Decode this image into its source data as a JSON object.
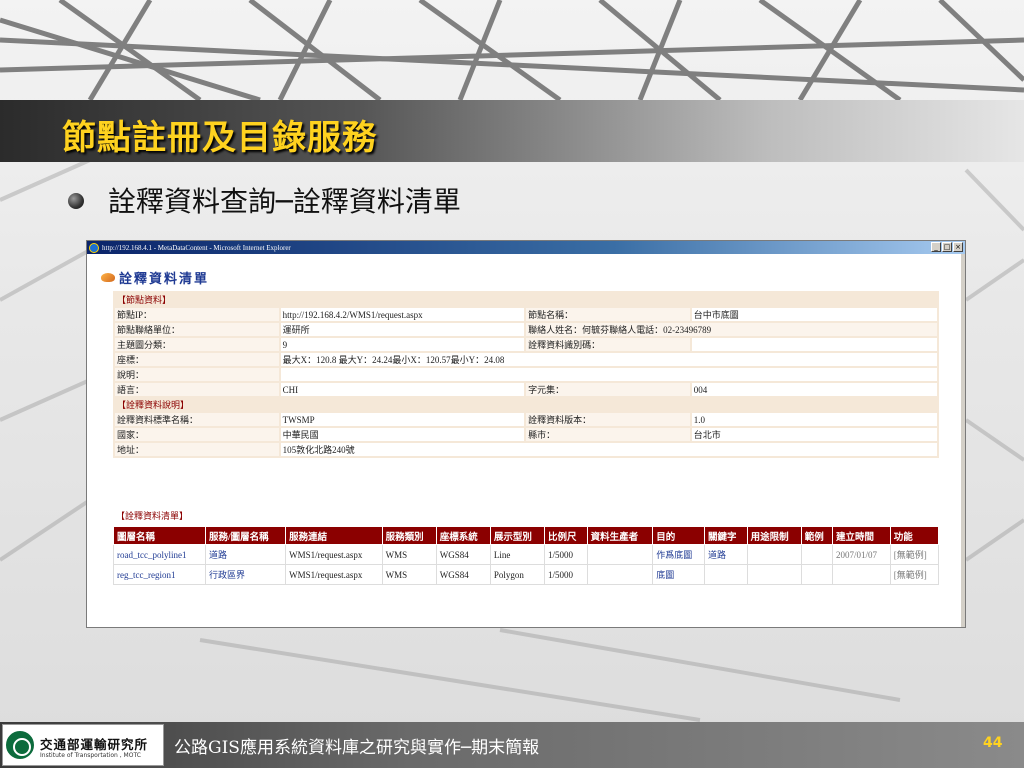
{
  "slide": {
    "title": "節點註冊及目錄服務",
    "bullet": "詮釋資料查詢─詮釋資料清單",
    "footer_text": "公路GIS應用系統資料庫之研究與實作─期末簡報",
    "page_number": "44",
    "org_name": "交通部運輸研究所",
    "org_name_en": "Institute of Transportation , MOTC"
  },
  "window": {
    "title": "http://192.168.4.1 - MetaDataContent - Microsoft Internet Explorer",
    "minimize": "_",
    "maximize": "□",
    "close": "×"
  },
  "page": {
    "heading": "詮釋資料清單",
    "node_section": "【節點資料】",
    "meta_section": "【詮釋資料說明】",
    "list_section": "【詮釋資料清單】"
  },
  "node_info": {
    "ip_label": "節點IP：",
    "ip_value": "http://192.168.4.2/WMS1/request.aspx",
    "name_label": "節點名稱：",
    "name_value": "台中市底圖",
    "unit_label": "節點聯絡單位：",
    "unit_value": "運研所",
    "contact_label": "聯絡人姓名：何毓芬聯絡人電話：02-23496789",
    "theme_label": "主題圖分類：",
    "theme_value": "9",
    "id_label": "詮釋資料識別碼：",
    "id_value": "",
    "coord_label": "座標：",
    "coord_value": "最大X：120.8 最大Y：24.24最小X：120.57最小Y：24.08",
    "desc_label": "說明：",
    "desc_value": "",
    "lang_label": "語言：",
    "lang_value": "CHI",
    "charset_label": "字元集：",
    "charset_value": "004"
  },
  "meta_info": {
    "std_label": "詮釋資料標準名稱：",
    "std_value": "TWSMP",
    "ver_label": "詮釋資料版本：",
    "ver_value": "1.0",
    "country_label": "國家：",
    "country_value": "中華民國",
    "city_label": "縣市：",
    "city_value": "台北市",
    "addr_label": "地址：",
    "addr_value": "105敦化北路240號"
  },
  "table": {
    "headers": [
      "圖層名稱",
      "服務/圖層名稱",
      "服務連結",
      "服務類別",
      "座標系統",
      "展示型別",
      "比例尺",
      "資料生產者",
      "目的",
      "關鍵字",
      "用途限制",
      "範例",
      "建立時間",
      "功能"
    ],
    "rows": [
      [
        "road_tcc_polyline1",
        "道路",
        "WMS1/request.aspx",
        "WMS",
        "WGS84",
        "Line",
        "1/5000",
        "",
        "作爲底圖",
        "道路",
        "",
        "",
        "2007/01/07",
        "[無範例]"
      ],
      [
        "reg_tcc_region1",
        "行政區界",
        "WMS1/request.aspx",
        "WMS",
        "WGS84",
        "Polygon",
        "1/5000",
        "",
        "底圖",
        "",
        "",
        "",
        "",
        "[無範例]"
      ]
    ]
  },
  "colors": {
    "title": "#ffd21f",
    "header_bg": "#8b0000",
    "link": "#1f3a93"
  }
}
